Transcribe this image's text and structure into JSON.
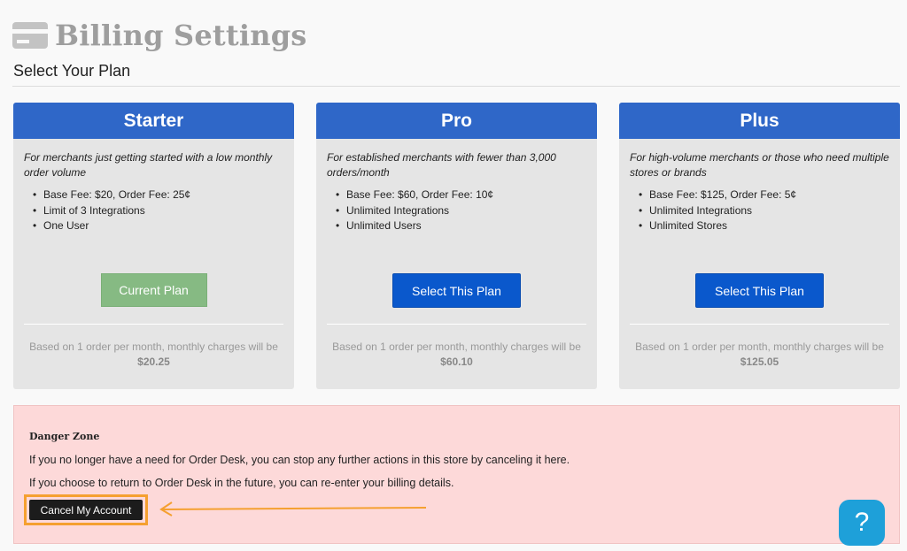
{
  "header": {
    "icon": "credit-card-icon",
    "title": "Billing Settings"
  },
  "subtitle": "Select Your Plan",
  "plans": [
    {
      "name": "Starter",
      "description": "For merchants just getting started with a low monthly order volume",
      "features": [
        "Base Fee: $20, Order Fee: 25¢",
        "Limit of 3 Integrations",
        "One User"
      ],
      "button_label": "Current Plan",
      "footer_text": "Based on 1 order per month, monthly charges will be",
      "footer_amount": "$20.25"
    },
    {
      "name": "Pro",
      "description": "For established merchants with fewer than 3,000 orders/month",
      "features": [
        "Base Fee: $60, Order Fee: 10¢",
        "Unlimited Integrations",
        "Unlimited Users"
      ],
      "button_label": "Select This Plan",
      "footer_text": "Based on 1 order per month, monthly charges will be",
      "footer_amount": "$60.10"
    },
    {
      "name": "Plus",
      "description": "For high-volume merchants or those who need multiple stores or brands",
      "features": [
        "Base Fee: $125, Order Fee: 5¢",
        "Unlimited Integrations",
        "Unlimited Stores"
      ],
      "button_label": "Select This Plan",
      "footer_text": "Based on 1 order per month, monthly charges will be",
      "footer_amount": "$125.05"
    }
  ],
  "danger_zone": {
    "title": "Danger Zone",
    "line1": "If you no longer have a need for Order Desk, you can stop any further actions in this store by canceling it here.",
    "line2": "If you choose to return to Order Desk in the future, you can re-enter your billing details.",
    "cancel_label": "Cancel My Account"
  },
  "help": {
    "icon": "question-icon",
    "label": "?"
  },
  "colors": {
    "plan_header": "#2f67c8",
    "current_plan_button": "#86ba83",
    "select_button": "#0a58cc",
    "danger_bg": "#fdd9d9",
    "highlight": "#f5a030",
    "help_button": "#1ea0d9"
  }
}
